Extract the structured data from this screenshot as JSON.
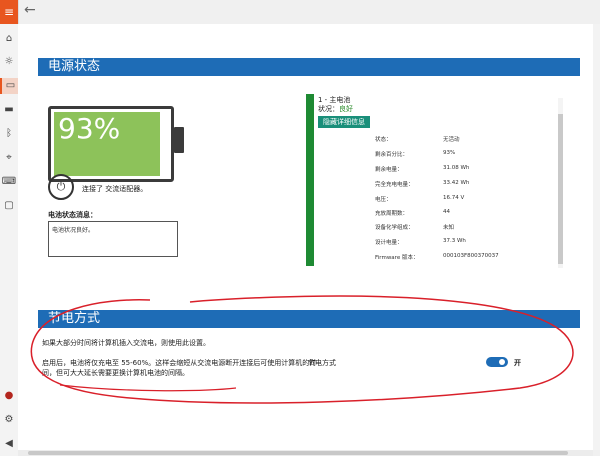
{
  "nav": {
    "back_arrow": "←",
    "menu_glyph": "≡",
    "icons": [
      {
        "name": "home-icon",
        "glyph": "⌂"
      },
      {
        "name": "lightbulb-icon",
        "glyph": "☼"
      },
      {
        "name": "battery-icon",
        "glyph": "▭"
      },
      {
        "name": "display-icon",
        "glyph": "▬"
      },
      {
        "name": "bluetooth-icon",
        "glyph": "ᛒ"
      },
      {
        "name": "mouse-icon",
        "glyph": "⌖"
      },
      {
        "name": "keyboard-icon",
        "glyph": "⌨"
      },
      {
        "name": "monitor-icon",
        "glyph": "▢"
      },
      {
        "name": "user-icon",
        "glyph": "●"
      },
      {
        "name": "settings-icon",
        "glyph": "⚙"
      },
      {
        "name": "feedback-icon",
        "glyph": "◀"
      }
    ]
  },
  "power_status": {
    "section_title": "电源状态",
    "battery_percent": "93%",
    "battery_fill_fraction": 0.93,
    "plug_glyph": "⏻",
    "adapter_text": "连接了 交流适配器。",
    "status_message_label": "电池状态消息：",
    "status_message": "电池状况良好。",
    "battery_name": "1 - 主电池",
    "status_label": "状况：",
    "status_value": "良好",
    "details_button": "隐藏详细信息",
    "details": [
      {
        "key": "状态：",
        "value": "无活动"
      },
      {
        "key": "剩余百分比：",
        "value": "93%"
      },
      {
        "key": "剩余电量：",
        "value": "31.08 Wh"
      },
      {
        "key": "完全充电电量：",
        "value": "33.42 Wh"
      },
      {
        "key": "电压：",
        "value": "16.74 V"
      },
      {
        "key": "充放周期数：",
        "value": "44"
      },
      {
        "key": "设备化学组成：",
        "value": "未知"
      },
      {
        "key": "设计电量：",
        "value": "37.3 Wh"
      },
      {
        "key": "Firmware 版本：",
        "value": "000103F800370037"
      }
    ]
  },
  "power_saving": {
    "section_title": "节电方式",
    "line1": "如果大部分时间将计算机插入交流电，则使用此设置。",
    "line2": "启用后，电池将仅充电至 55-60%。这样会缩短从交流电源断开连接后可使用计算机的时间，但可大大延长需要更换计算机电池的间隔。",
    "toggle_label": "节电方式",
    "toggle_state": "开"
  },
  "colors": {
    "accent": "#1e6cb6",
    "menu": "#e8561f",
    "battery_fill": "#8dc25a",
    "battery_bar": "#1e8a33",
    "details_button": "#1a8f7a",
    "annotation": "#d9202a"
  }
}
